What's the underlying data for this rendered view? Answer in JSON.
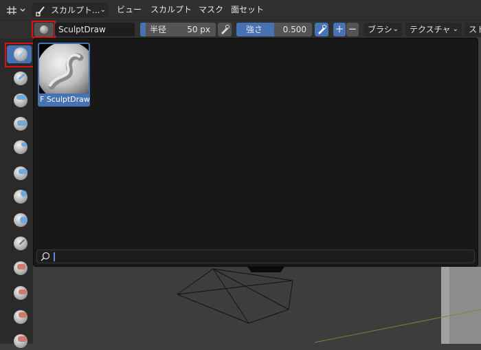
{
  "topbar": {
    "mode_label": "スカルプト...",
    "menus": [
      "ビュー",
      "スカルプト",
      "マスク",
      "面セット"
    ]
  },
  "header": {
    "brush_name": "SculptDraw",
    "radius": {
      "label": "半径",
      "value": "50 px"
    },
    "strength": {
      "label": "強さ",
      "value": "0.500"
    },
    "plus": "+",
    "minus": "−",
    "dropdowns": [
      "ブラシ",
      "テクスチャ",
      "スト"
    ]
  },
  "popup": {
    "brush_card_label": "F SculptDraw",
    "search_value": ""
  },
  "colors": {
    "accent": "#4772b3",
    "highlight": "#e0101b"
  }
}
